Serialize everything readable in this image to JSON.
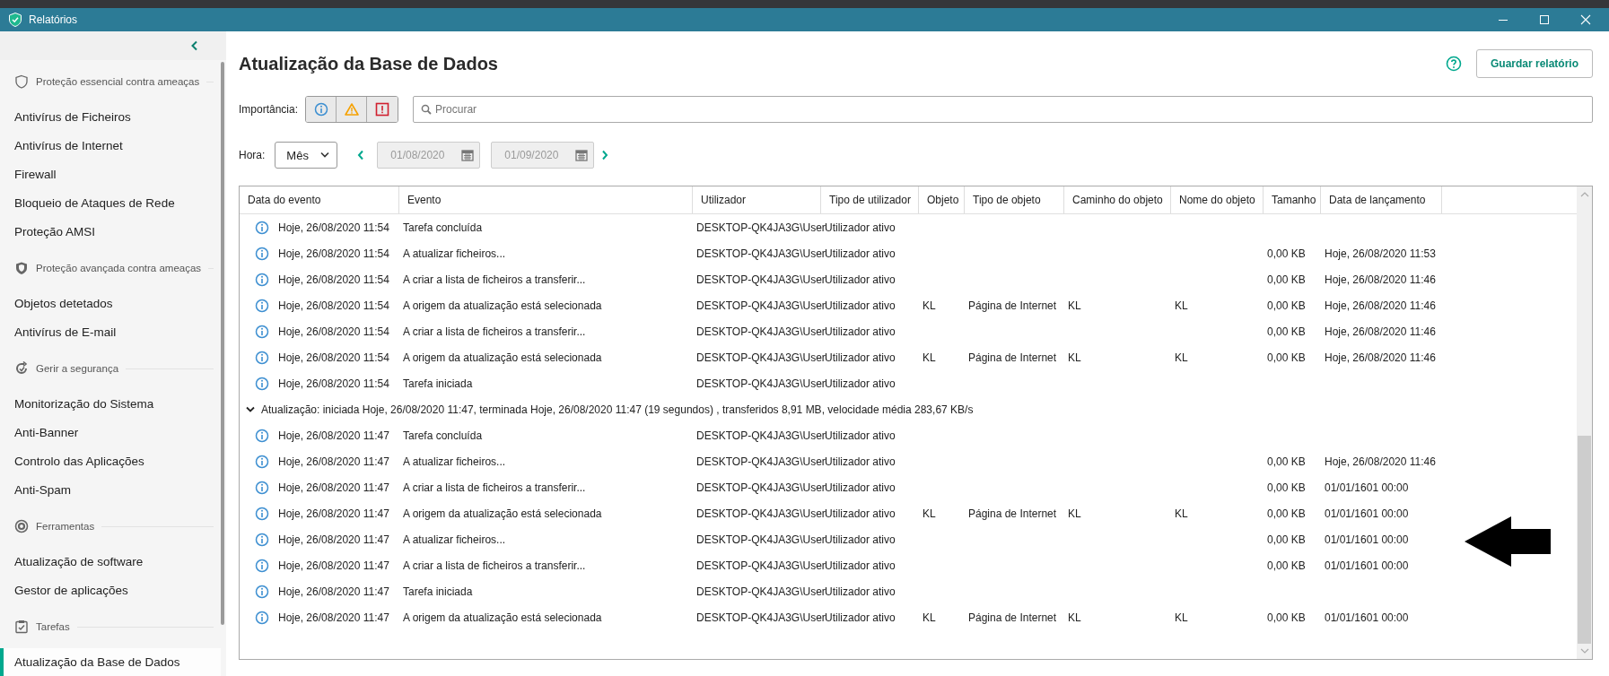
{
  "window": {
    "title": "Relatórios"
  },
  "sidebar": {
    "sections": [
      {
        "kind": "shield",
        "title": "Proteção essencial contra ameaças",
        "items": [
          {
            "label": "Antivírus de Ficheiros",
            "selected": false
          },
          {
            "label": "Antivírus de Internet",
            "selected": false
          },
          {
            "label": "Firewall",
            "selected": false
          },
          {
            "label": "Bloqueio de Ataques de Rede",
            "selected": false
          },
          {
            "label": "Proteção AMSI",
            "selected": false
          }
        ]
      },
      {
        "kind": "shield-dark",
        "title": "Proteção avançada contra ameaças",
        "items": [
          {
            "label": "Objetos detetados",
            "selected": false
          },
          {
            "label": "Antivírus de E-mail",
            "selected": false
          }
        ]
      },
      {
        "kind": "refresh",
        "title": "Gerir a segurança",
        "items": [
          {
            "label": "Monitorização do Sistema",
            "selected": false
          },
          {
            "label": "Anti-Banner",
            "selected": false
          },
          {
            "label": "Controlo das Aplicações",
            "selected": false
          },
          {
            "label": "Anti-Spam",
            "selected": false
          }
        ]
      },
      {
        "kind": "tools",
        "title": "Ferramentas",
        "items": [
          {
            "label": "Atualização de software",
            "selected": false
          },
          {
            "label": "Gestor de aplicações",
            "selected": false
          }
        ]
      },
      {
        "kind": "tasks",
        "title": "Tarefas",
        "items": [
          {
            "label": "Atualização da Base de Dados",
            "selected": true
          }
        ]
      }
    ]
  },
  "report": {
    "title": "Atualização da Base de Dados",
    "save_button": "Guardar relatório",
    "importance": {
      "label": "Importância:",
      "filters": [
        {
          "kind": "info"
        },
        {
          "kind": "warning"
        },
        {
          "kind": "error"
        }
      ]
    },
    "search": {
      "placeholder": "Procurar"
    },
    "time": {
      "label": "Hora:",
      "period": "Mês",
      "from": {
        "value": "01/08/2020",
        "disabled": true
      },
      "to": {
        "value": "01/09/2020",
        "disabled": true
      }
    }
  },
  "table": {
    "columns": [
      "Data do evento",
      "Evento",
      "Utilizador",
      "Tipo de utilizador",
      "Objeto",
      "Tipo de objeto",
      "Caminho do objeto",
      "Nome do objeto",
      "Tamanho",
      "Data de lançamento"
    ],
    "rows": [
      {
        "kind": "info",
        "cells": [
          "Hoje, 26/08/2020 11:54",
          "Tarefa concluída",
          "DESKTOP-QK4JA3G\\User",
          "Utilizador ativo",
          null,
          null,
          null,
          null,
          null,
          null
        ]
      },
      {
        "kind": "info",
        "cells": [
          "Hoje, 26/08/2020 11:54",
          "A atualizar ficheiros...",
          "DESKTOP-QK4JA3G\\User",
          "Utilizador ativo",
          null,
          null,
          null,
          null,
          "0,00 KB",
          "Hoje, 26/08/2020 11:53"
        ]
      },
      {
        "kind": "info",
        "cells": [
          "Hoje, 26/08/2020 11:54",
          "A criar a lista de ficheiros a transferir...",
          "DESKTOP-QK4JA3G\\User",
          "Utilizador ativo",
          null,
          null,
          null,
          null,
          "0,00 KB",
          "Hoje, 26/08/2020 11:46"
        ]
      },
      {
        "kind": "info",
        "cells": [
          "Hoje, 26/08/2020 11:54",
          "A origem da atualização está selecionada",
          "DESKTOP-QK4JA3G\\User",
          "Utilizador ativo",
          "KL",
          "Página de Internet",
          "KL",
          "KL",
          "0,00 KB",
          "Hoje, 26/08/2020 11:46"
        ]
      },
      {
        "kind": "info",
        "cells": [
          "Hoje, 26/08/2020 11:54",
          "A criar a lista de ficheiros a transferir...",
          "DESKTOP-QK4JA3G\\User",
          "Utilizador ativo",
          null,
          null,
          null,
          null,
          "0,00 KB",
          "Hoje, 26/08/2020 11:46"
        ]
      },
      {
        "kind": "info",
        "cells": [
          "Hoje, 26/08/2020 11:54",
          "A origem da atualização está selecionada",
          "DESKTOP-QK4JA3G\\User",
          "Utilizador ativo",
          "KL",
          "Página de Internet",
          "KL",
          "KL",
          "0,00 KB",
          "Hoje, 26/08/2020 11:46"
        ]
      },
      {
        "kind": "info",
        "cells": [
          "Hoje, 26/08/2020 11:54",
          "Tarefa iniciada",
          "DESKTOP-QK4JA3G\\User",
          "Utilizador ativo",
          null,
          null,
          null,
          null,
          null,
          null
        ]
      },
      {
        "kind": "group",
        "expanded": true,
        "text": "Atualização: iniciada Hoje, 26/08/2020 11:47, terminada Hoje, 26/08/2020 11:47 (19 segundos) , transferidos 8,91 MB, velocidade média 283,67 KB/s"
      },
      {
        "kind": "info",
        "cells": [
          "Hoje, 26/08/2020 11:47",
          "Tarefa concluída",
          "DESKTOP-QK4JA3G\\User",
          "Utilizador ativo",
          null,
          null,
          null,
          null,
          null,
          null
        ]
      },
      {
        "kind": "info",
        "cells": [
          "Hoje, 26/08/2020 11:47",
          "A atualizar ficheiros...",
          "DESKTOP-QK4JA3G\\User",
          "Utilizador ativo",
          null,
          null,
          null,
          null,
          "0,00 KB",
          "Hoje, 26/08/2020 11:46"
        ]
      },
      {
        "kind": "info",
        "cells": [
          "Hoje, 26/08/2020 11:47",
          "A criar a lista de ficheiros a transferir...",
          "DESKTOP-QK4JA3G\\User",
          "Utilizador ativo",
          null,
          null,
          null,
          null,
          "0,00 KB",
          "01/01/1601 00:00"
        ]
      },
      {
        "kind": "info",
        "cells": [
          "Hoje, 26/08/2020 11:47",
          "A origem da atualização está selecionada",
          "DESKTOP-QK4JA3G\\User",
          "Utilizador ativo",
          "KL",
          "Página de Internet",
          "KL",
          "KL",
          "0,00 KB",
          "01/01/1601 00:00"
        ]
      },
      {
        "kind": "info",
        "cells": [
          "Hoje, 26/08/2020 11:47",
          "A atualizar ficheiros...",
          "DESKTOP-QK4JA3G\\User",
          "Utilizador ativo",
          null,
          null,
          null,
          null,
          "0,00 KB",
          "01/01/1601 00:00"
        ]
      },
      {
        "kind": "info",
        "cells": [
          "Hoje, 26/08/2020 11:47",
          "A criar a lista de ficheiros a transferir...",
          "DESKTOP-QK4JA3G\\User",
          "Utilizador ativo",
          null,
          null,
          null,
          null,
          "0,00 KB",
          "01/01/1601 00:00"
        ]
      },
      {
        "kind": "info",
        "cells": [
          "Hoje, 26/08/2020 11:47",
          "Tarefa iniciada",
          "DESKTOP-QK4JA3G\\User",
          "Utilizador ativo",
          null,
          null,
          null,
          null,
          null,
          null
        ]
      },
      {
        "kind": "info",
        "cells": [
          "Hoje, 26/08/2020 11:47",
          "A origem da atualização está selecionada",
          "DESKTOP-QK4JA3G\\User",
          "Utilizador ativo",
          "KL",
          "Página de Internet",
          "KL",
          "KL",
          "0,00 KB",
          "01/01/1601 00:00"
        ]
      }
    ]
  }
}
